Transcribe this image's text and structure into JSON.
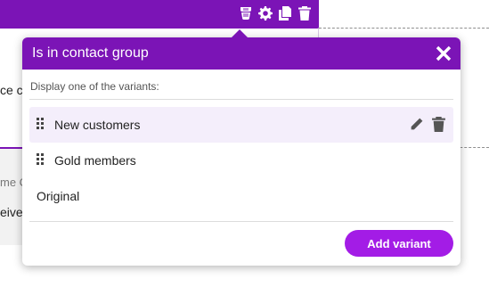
{
  "background": {
    "partial_text_1": "ce c",
    "partial_text_2": "me C",
    "partial_text_3": "eive"
  },
  "popover": {
    "title": "Is in contact group",
    "subtitle": "Display one of the variants:",
    "variants": [
      {
        "label": "New customers"
      },
      {
        "label": "Gold members"
      },
      {
        "label": "Original"
      }
    ],
    "add_variant_label": "Add variant"
  },
  "colors": {
    "accent": "#7b14b6",
    "button": "#a31ce6",
    "hover_row": "#f4eefb"
  }
}
